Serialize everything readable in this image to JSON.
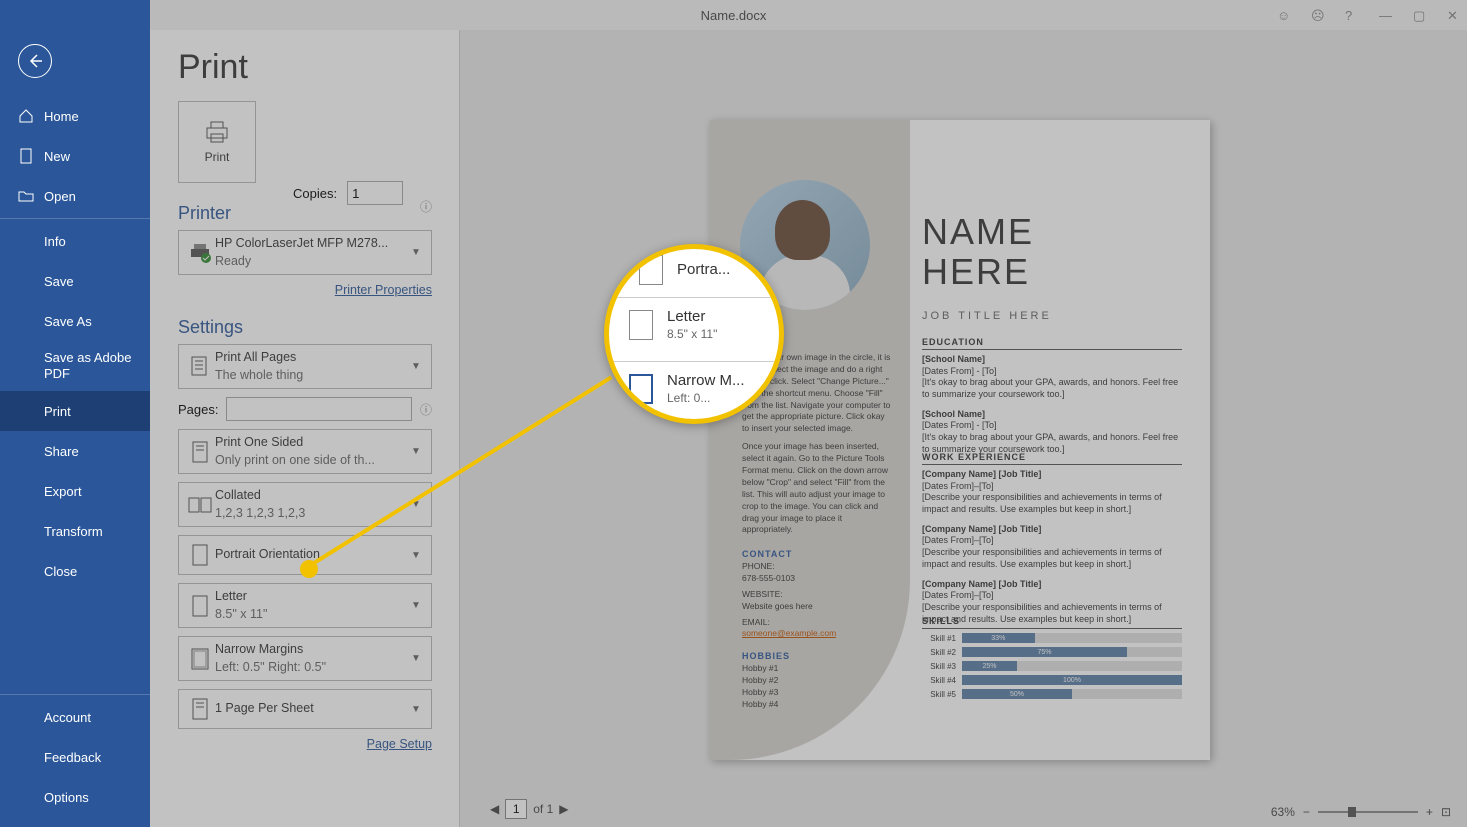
{
  "window": {
    "title": "Name.docx"
  },
  "nav": {
    "home": "Home",
    "new": "New",
    "open": "Open",
    "info": "Info",
    "save": "Save",
    "saveas": "Save As",
    "adobe": "Save as Adobe PDF",
    "print": "Print",
    "share": "Share",
    "export": "Export",
    "transform": "Transform",
    "close": "Close",
    "account": "Account",
    "feedback": "Feedback",
    "options": "Options"
  },
  "print": {
    "heading": "Print",
    "print_btn": "Print",
    "copies_label": "Copies:",
    "copies_value": "1",
    "printer_h": "Printer",
    "printer_name": "HP ColorLaserJet MFP M278...",
    "printer_status": "Ready",
    "printer_props": "Printer Properties",
    "settings_h": "Settings",
    "all_pages": "Print All Pages",
    "all_pages_sub": "The whole thing",
    "pages_label": "Pages:",
    "one_sided": "Print One Sided",
    "one_sided_sub": "Only print on one side of th...",
    "collated": "Collated",
    "collated_sub": "1,2,3    1,2,3    1,2,3",
    "orientation": "Portrait Orientation",
    "size": "Letter",
    "size_sub": "8.5\" x 11\"",
    "margins": "Narrow Margins",
    "margins_sub": "Left:  0.5\"    Right:  0.5\"",
    "per_sheet": "1 Page Per Sheet",
    "page_setup": "Page Setup"
  },
  "preview": {
    "page_current": "1",
    "page_of": "of 1",
    "zoom_pct": "63%",
    "resume": {
      "name": "NAME HERE",
      "job": "JOB TITLE HERE",
      "edu_h": "EDUCATION",
      "school": "[School Name]",
      "dates": "[Dates From] - [To]",
      "edu_desc": "[It's okay to brag about your GPA, awards, and honors. Feel free to summarize your coursework too.]",
      "work_h": "WORK EXPERIENCE",
      "company": "[Company Name]  [Job Title]",
      "dates2": "[Dates From]–[To]",
      "work_desc": "[Describe your responsibilities and achievements in terms of impact and results. Use examples but keep in short.]",
      "skills_h": "SKILLS",
      "contact_h": "CONTACT",
      "phone_l": "PHONE:",
      "phone": "678-555-0103",
      "web_l": "WEBSITE:",
      "web": "Website goes here",
      "email_l": "EMAIL:",
      "email": "someone@example.com",
      "hobbies_h": "HOBBIES",
      "h1": "Hobby #1",
      "h2": "Hobby #2",
      "h3": "Hobby #3",
      "h4": "Hobby #4",
      "left_text": "To put your own image in the circle, it is easy! Select the image and do a right mouse click. Select \"Change Picture...\" from the shortcut menu. Choose \"Fill\" from the list. Navigate your computer to get the appropriate picture. Click okay to insert your selected image.",
      "left_text2": "Once your image has been inserted, select it again. Go to the Picture Tools Format menu. Click on the down arrow below \"Crop\" and select \"Fill\" from the list. This will auto adjust your image to crop to the image. You can click and drag your image to place it appropriately.",
      "s1_l": "Skill #1",
      "s1_v": "33%",
      "s2_l": "Skill #2",
      "s2_v": "75%",
      "s3_l": "Skill #3",
      "s3_v": "25%",
      "s4_l": "Skill #4",
      "s4_v": "100%",
      "s5_l": "Skill #5",
      "s5_v": "50%"
    }
  },
  "magnifier": {
    "r1": "Portra...",
    "r2": "Letter",
    "r2_sub": "8.5\" x 11\"",
    "r3": "Narrow M...",
    "r3_sub": "Left:  0..."
  }
}
